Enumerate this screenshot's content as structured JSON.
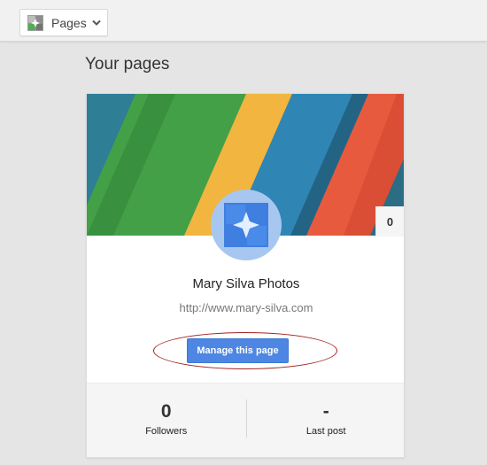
{
  "topbar": {
    "dropdown": {
      "label": "Pages",
      "icon": "google-plus-pages-icon",
      "chevron": "chevron-down-icon"
    }
  },
  "heading": "Your pages",
  "card": {
    "notification_count": "0",
    "page_name": "Mary Silva Photos",
    "page_url": "http://www.mary-silva.com",
    "manage_button": "Manage this page",
    "avatar_icon": "pages-avatar-icon",
    "cover_image": "colored-felt-strips-photo",
    "stats": {
      "followers_value": "0",
      "followers_label": "Followers",
      "last_post_value": "-",
      "last_post_label": "Last post"
    }
  },
  "colors": {
    "button_blue": "#4d87e3",
    "avatar_blue": "#a7c7f1",
    "highlight_red": "#a32221",
    "background": "#e5e5e5"
  }
}
